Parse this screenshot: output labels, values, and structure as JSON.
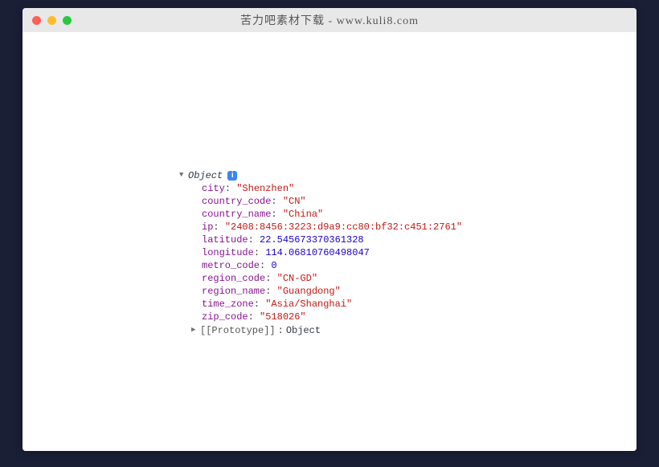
{
  "window": {
    "title": "苦力吧素材下载 - www.kuli8.com"
  },
  "console": {
    "object_label": "Object",
    "prototype_label": "[[Prototype]]",
    "prototype_value": "Object",
    "props": {
      "city_k": "city",
      "city_v": "\"Shenzhen\"",
      "country_code_k": "country_code",
      "country_code_v": "\"CN\"",
      "country_name_k": "country_name",
      "country_name_v": "\"China\"",
      "ip_k": "ip",
      "ip_v": "\"2408:8456:3223:d9a9:cc80:bf32:c451:2761\"",
      "latitude_k": "latitude",
      "latitude_v": "22.545673370361328",
      "longitude_k": "longitude",
      "longitude_v": "114.06810760498047",
      "metro_code_k": "metro_code",
      "metro_code_v": "0",
      "region_code_k": "region_code",
      "region_code_v": "\"CN-GD\"",
      "region_name_k": "region_name",
      "region_name_v": "\"Guangdong\"",
      "time_zone_k": "time_zone",
      "time_zone_v": "\"Asia/Shanghai\"",
      "zip_code_k": "zip_code",
      "zip_code_v": "\"518026\""
    }
  }
}
